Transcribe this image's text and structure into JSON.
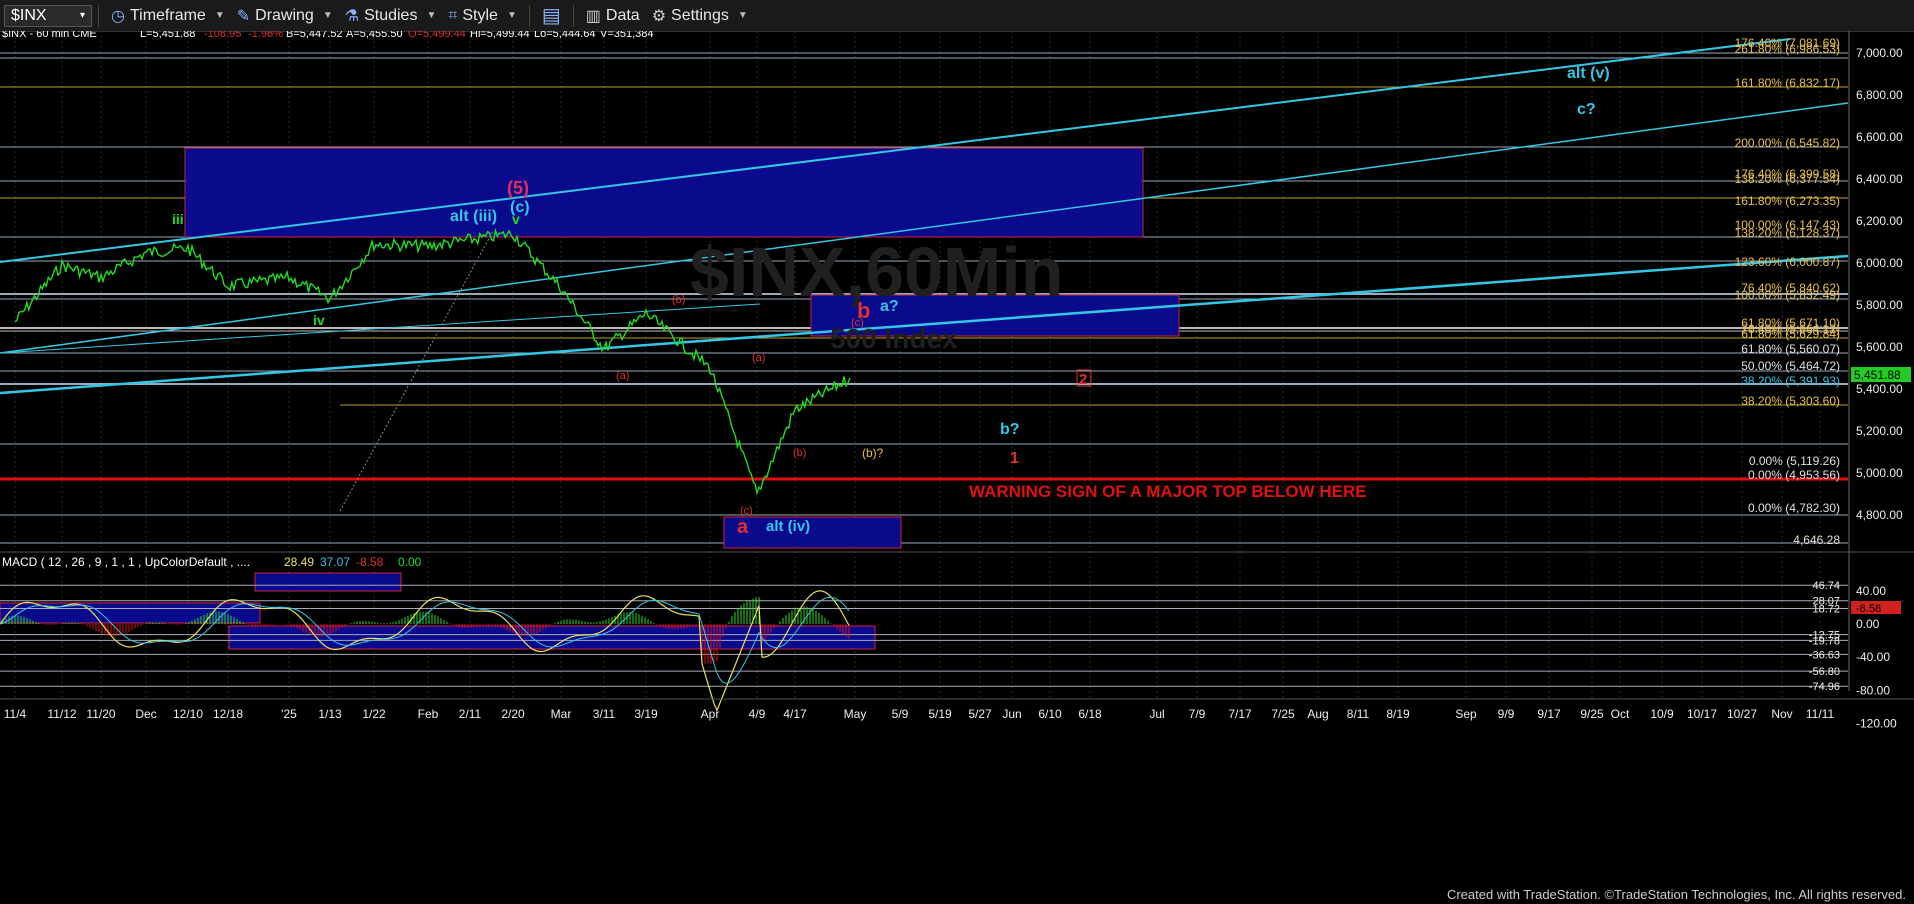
{
  "toolbar": {
    "symbol": "$INX",
    "timeframe": "Timeframe",
    "drawing": "Drawing",
    "studies": "Studies",
    "style": "Style",
    "data": "Data",
    "settings": "Settings"
  },
  "header": {
    "symbol_line": "$INX - 60 min  CME",
    "last": "L=5,451.88",
    "change": "-108.95",
    "change_pct": "-1.96%",
    "bid": "B=5,447.52",
    "ask": "A=5,455.50",
    "open": "O=5,499.44",
    "high": "Hi=5,499.44",
    "low": "Lo=5,444.64",
    "volume": "V=351,384"
  },
  "watermark": {
    "line1": "$INX,60Min",
    "line2": "500 Index"
  },
  "price_axis": {
    "ticks": [
      "7,000.00",
      "6,800.00",
      "6,600.00",
      "6,400.00",
      "6,200.00",
      "6,000.00",
      "5,800.00",
      "5,600.00",
      "5,400.00",
      "5,200.00",
      "5,000.00",
      "4,800.00"
    ],
    "last_price": "5,451.88"
  },
  "macd": {
    "label": "MACD ( 12 , 26 , 9 , 1 , 1 , UpColorDefault , ....",
    "v1": "28.49",
    "v2": "37.07",
    "v3": "-8.58",
    "v4": "0.00",
    "ticks": [
      "40.00",
      "0.00",
      "-40.00",
      "-80.00",
      "-120.00"
    ],
    "levels": [
      "46.74",
      "28.07",
      "18.72",
      "-12.75",
      "-19.78",
      "-36.63",
      "-56.80",
      "-74.96"
    ],
    "current": "-8.58"
  },
  "fib_labels": [
    "176.40% (7,081.69)",
    "261.80% (6,986.53)",
    "161.80% (6,832.17)",
    "200.00% (6,545.82)",
    "176.40% (6,399.58)",
    "138.20% (6,377.54)",
    "161.80% (6,273.35)",
    "100.00% (6,147.43)",
    "138.20% (6,128.37)",
    "123.60% (6,000.87)",
    "76.40% (5,840.62)",
    "100.00% (5,832.49)",
    "61.80% (5,671.10)",
    "76.40% (5,664.12)",
    "61.80% (5,629.84)",
    "61.80% (5,560.07)",
    "50.00% (5,464.72)",
    "38.20% (5,391.93)",
    "38.20% (5,303.60)",
    "0.00% (5,119.26)",
    "0.00% (4,953.56)",
    "0.00% (4,782.30)",
    "4,646.28"
  ],
  "wave_labels": {
    "alt_v": "alt (v)",
    "c_q": "c?",
    "five": "(5)",
    "c_paren": "(c)",
    "v": "v",
    "alt_iii": "alt (iii)",
    "iii": "iii",
    "iv": "iv",
    "b_paren": "(b)",
    "a_paren": "(a)",
    "a_paren2": "(a)",
    "b": "b",
    "a_q": "a?",
    "c_small": "(c)",
    "two": "2",
    "b_q": "b?",
    "b_paren2": "(b)",
    "b_paren_q": "(b)?",
    "one": "1",
    "c_bottom": "(c)",
    "a_big": "a",
    "alt_iv": "alt (iv)"
  },
  "warning_text": "WARNING SIGN OF A MAJOR TOP BELOW HERE",
  "time_axis": [
    "11/4",
    "11/12",
    "11/20",
    "Dec",
    "12/10",
    "12/18",
    "'25",
    "1/13",
    "1/22",
    "Feb",
    "2/11",
    "2/20",
    "Mar",
    "3/11",
    "3/19",
    "Apr",
    "4/9",
    "4/17",
    "May",
    "5/9",
    "5/19",
    "5/27",
    "Jun",
    "6/10",
    "6/18",
    "Jul",
    "7/9",
    "7/17",
    "7/25",
    "Aug",
    "8/11",
    "8/19",
    "Sep",
    "9/9",
    "9/17",
    "9/25",
    "Oct",
    "10/9",
    "10/17",
    "10/27",
    "Nov",
    "11/11"
  ],
  "footer": "Created with TradeStation. ©TradeStation Technologies, Inc. All rights reserved.",
  "chart_data": {
    "type": "line",
    "symbol": "$INX",
    "interval": "60 min",
    "ylim": [
      4700,
      7100
    ],
    "series": [
      {
        "x": [
          "11/4",
          "11/12",
          "11/20",
          "Dec",
          "12/10",
          "12/18",
          "'25",
          "1/13",
          "1/22",
          "Feb",
          "2/11",
          "2/20",
          "Mar",
          "3/11",
          "3/19",
          "Apr",
          "4/9",
          "4/17"
        ],
        "values": [
          5720,
          5990,
          5930,
          6050,
          6070,
          5890,
          5930,
          5830,
          6090,
          6080,
          6110,
          6140,
          5880,
          5590,
          5760,
          5500,
          4900,
          5300
        ]
      }
    ],
    "last_value": 5451.88,
    "colors": {
      "price": "#22dd22",
      "cyan": "#33c7e6",
      "box": "#0a0a8c",
      "warning": "#e01010",
      "fib_text": "#f0c040"
    }
  }
}
